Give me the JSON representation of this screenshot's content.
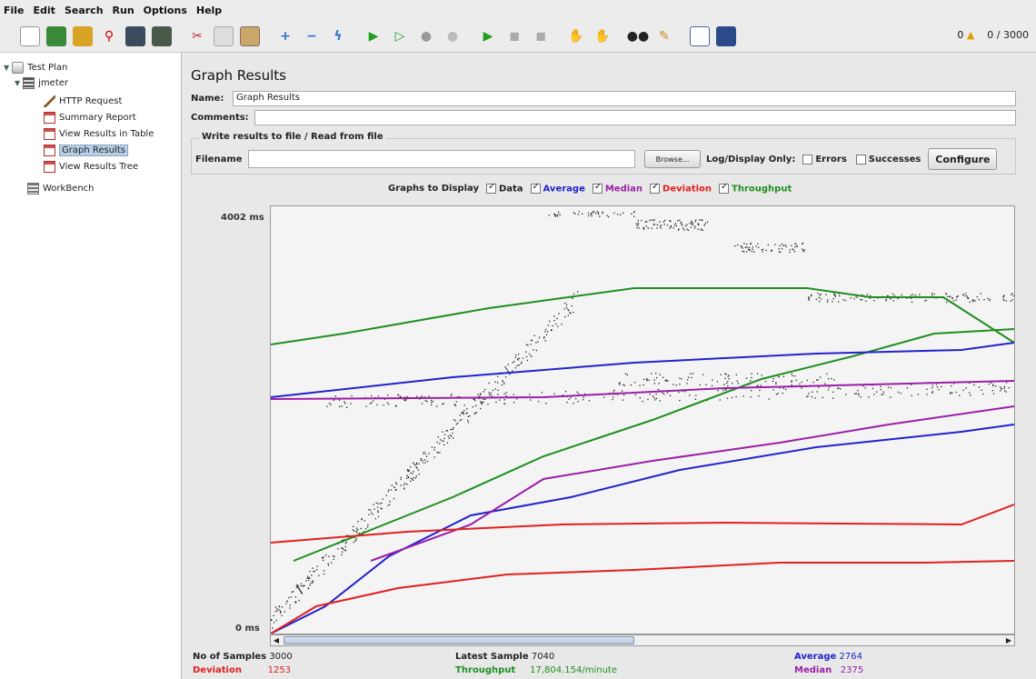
{
  "menu": [
    "File",
    "Edit",
    "Search",
    "Run",
    "Options",
    "Help"
  ],
  "toolbar": {
    "buttons": [
      "new-icon",
      "templates-icon",
      "open-icon",
      "close-icon",
      "save-icon",
      "save-as-icon",
      "cut-icon",
      "copy-icon",
      "paste-icon",
      "expand-icon",
      "collapse-icon",
      "toggle-icon",
      "start-icon",
      "start-no-pause-icon",
      "stop-icon",
      "shutdown-icon",
      "remote-start-icon",
      "remote-stop-icon",
      "remote-shutdown-icon",
      "clear-icon",
      "clear-all-icon",
      "search-icon",
      "reset-search-icon",
      "function-helper-icon",
      "help-icon"
    ],
    "warnings": "0",
    "threads": "0 / 3000"
  },
  "tree": {
    "nodes": [
      {
        "label": "Test Plan"
      },
      {
        "label": "jmeter"
      },
      {
        "label": "HTTP Request"
      },
      {
        "label": "Summary Report"
      },
      {
        "label": "View Results in Table"
      },
      {
        "label": "Graph Results"
      },
      {
        "label": "View Results Tree"
      },
      {
        "label": "WorkBench"
      }
    ]
  },
  "panel": {
    "title": "Graph Results",
    "name_label": "Name:",
    "name_value": "Graph Results",
    "comments_label": "Comments:",
    "file_group_title": "Write results to file / Read from file",
    "filename_label": "Filename",
    "browse_label": "Browse...",
    "log_display_label": "Log/Display Only:",
    "errors_label": "Errors",
    "successes_label": "Successes",
    "configure_label": "Configure",
    "graphs_label": "Graphs to Display",
    "graph_options": [
      {
        "label": "Data",
        "color": "#222222"
      },
      {
        "label": "Average",
        "color": "#2222cc"
      },
      {
        "label": "Median",
        "color": "#9a1fa8"
      },
      {
        "label": "Deviation",
        "color": "#e02020"
      },
      {
        "label": "Throughput",
        "color": "#1f8f1f"
      }
    ]
  },
  "chart_data": {
    "type": "line",
    "y_max_label": "4002 ms",
    "y_min_label": "0 ms",
    "ylim": [
      0,
      4002
    ],
    "series": [
      {
        "name": "Data",
        "color": "#222222"
      },
      {
        "name": "Average",
        "color": "#2222cc"
      },
      {
        "name": "Median",
        "color": "#9a1fa8"
      },
      {
        "name": "Deviation",
        "color": "#e02020"
      },
      {
        "name": "Throughput",
        "color": "#1f8f1f"
      }
    ]
  },
  "stats": {
    "samples_label": "No of Samples",
    "samples": "3000",
    "deviation_label": "Deviation",
    "deviation": "1253",
    "latest_label": "Latest Sample",
    "latest": "7040",
    "throughput_label": "Throughput",
    "throughput": "17,804.154/minute",
    "average_label": "Average",
    "average": "2764",
    "median_label": "Median",
    "median": "2375"
  }
}
